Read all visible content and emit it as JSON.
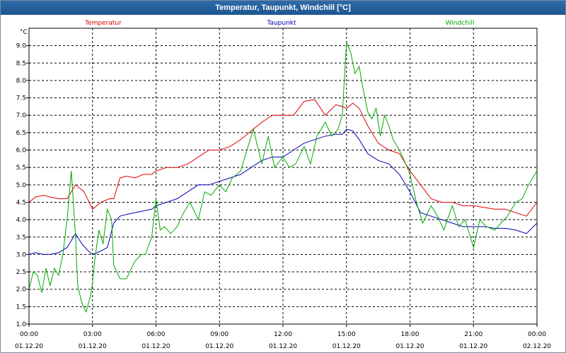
{
  "window": {
    "title": "Temperatur, Taupunkt, Windchill [°C]"
  },
  "colors": {
    "temperatur": "#dd0000",
    "taupunkt": "#0000bb",
    "windchill": "#00aa00",
    "grid": "#000000"
  },
  "chart_data": {
    "type": "line",
    "title": "Temperatur, Taupunkt, Windchill [°C]",
    "ylabel": "°C",
    "ylim": [
      1.0,
      9.5
    ],
    "xlim": [
      0,
      24
    ],
    "yticks": [
      1.0,
      1.5,
      2.0,
      2.5,
      3.0,
      3.5,
      4.0,
      4.5,
      5.0,
      5.5,
      6.0,
      6.5,
      7.0,
      7.5,
      8.0,
      8.5,
      9.0
    ],
    "ytick_labels": [
      "1.0",
      "1.5",
      "2.0",
      "2.5",
      "3.0",
      "3.5",
      "4.0",
      "4.5",
      "5.0",
      "5.5",
      "6.0",
      "6.5",
      "7.0",
      "7.5",
      "8.0",
      "8.5",
      "9.0"
    ],
    "xticks": [
      {
        "time": "00:00",
        "date": "01.12.20"
      },
      {
        "time": "03:00",
        "date": "01.12.20"
      },
      {
        "time": "06:00",
        "date": "01.12.20"
      },
      {
        "time": "09:00",
        "date": "01.12.20"
      },
      {
        "time": "12:00",
        "date": "01.12.20"
      },
      {
        "time": "15:00",
        "date": "01.12.20"
      },
      {
        "time": "18:00",
        "date": "01.12.20"
      },
      {
        "time": "21:00",
        "date": "01.12.20"
      },
      {
        "time": "00:00",
        "date": "02.12.20"
      }
    ],
    "grid": true,
    "series": [
      {
        "name": "Temperatur",
        "color": "#dd0000",
        "x": [
          0,
          0.3,
          0.7,
          1.0,
          1.4,
          1.8,
          2.2,
          2.6,
          3.0,
          3.4,
          3.8,
          4.0,
          4.3,
          4.6,
          5.0,
          5.4,
          5.8,
          6.0,
          6.5,
          7.0,
          7.5,
          8.0,
          8.5,
          9.0,
          9.5,
          10.0,
          10.5,
          11.0,
          11.5,
          12.0,
          12.5,
          13.0,
          13.5,
          14.0,
          14.5,
          14.8,
          15.0,
          15.3,
          15.6,
          16.0,
          16.5,
          17.0,
          17.5,
          18.0,
          18.5,
          19.0,
          19.5,
          20.0,
          20.5,
          21.0,
          21.5,
          22.0,
          22.5,
          23.0,
          23.5,
          24.0
        ],
        "values": [
          4.5,
          4.65,
          4.7,
          4.65,
          4.6,
          4.6,
          5.0,
          4.8,
          4.3,
          4.5,
          4.6,
          4.6,
          5.2,
          5.25,
          5.2,
          5.3,
          5.3,
          5.4,
          5.5,
          5.5,
          5.6,
          5.8,
          6.0,
          6.0,
          6.1,
          6.3,
          6.55,
          6.8,
          7.0,
          7.0,
          7.0,
          7.4,
          7.45,
          7.0,
          7.3,
          7.25,
          7.2,
          7.35,
          7.2,
          6.7,
          6.2,
          6.0,
          5.9,
          5.4,
          5.0,
          4.6,
          4.5,
          4.5,
          4.4,
          4.4,
          4.35,
          4.3,
          4.3,
          4.2,
          4.1,
          4.5
        ]
      },
      {
        "name": "Taupunkt",
        "color": "#0000bb",
        "x": [
          0,
          0.3,
          0.7,
          1.0,
          1.4,
          1.8,
          2.2,
          2.5,
          2.8,
          3.0,
          3.4,
          3.7,
          4.0,
          4.3,
          4.6,
          5.0,
          5.4,
          5.8,
          6.0,
          6.5,
          7.0,
          7.5,
          8.0,
          8.5,
          9.0,
          9.5,
          10.0,
          10.5,
          11.0,
          11.5,
          12.0,
          12.5,
          13.0,
          13.5,
          14.0,
          14.5,
          14.8,
          15.0,
          15.3,
          15.6,
          16.0,
          16.5,
          17.0,
          17.5,
          18.0,
          18.5,
          19.0,
          19.5,
          20.0,
          20.5,
          21.0,
          21.5,
          22.0,
          22.5,
          23.0,
          23.5,
          24.0
        ],
        "values": [
          3.0,
          3.05,
          3.0,
          3.0,
          3.05,
          3.2,
          3.6,
          3.3,
          3.1,
          3.0,
          3.1,
          3.2,
          3.9,
          4.1,
          4.15,
          4.2,
          4.25,
          4.3,
          4.4,
          4.5,
          4.6,
          4.8,
          5.0,
          5.0,
          5.1,
          5.2,
          5.3,
          5.5,
          5.7,
          5.8,
          5.8,
          6.0,
          6.2,
          6.3,
          6.4,
          6.45,
          6.45,
          6.6,
          6.55,
          6.3,
          5.9,
          5.7,
          5.6,
          5.3,
          4.8,
          4.2,
          4.1,
          4.0,
          3.9,
          3.8,
          3.8,
          3.8,
          3.75,
          3.75,
          3.7,
          3.6,
          3.9
        ]
      },
      {
        "name": "Windchill",
        "color": "#00aa00",
        "x": [
          0,
          0.2,
          0.4,
          0.6,
          0.8,
          1.0,
          1.2,
          1.4,
          1.6,
          1.8,
          2.0,
          2.2,
          2.3,
          2.5,
          2.7,
          2.9,
          3.0,
          3.1,
          3.3,
          3.5,
          3.7,
          3.9,
          4.0,
          4.3,
          4.6,
          5.0,
          5.3,
          5.5,
          5.8,
          6.0,
          6.2,
          6.4,
          6.7,
          7.0,
          7.3,
          7.6,
          8.0,
          8.3,
          8.6,
          9.0,
          9.3,
          9.6,
          10.0,
          10.3,
          10.6,
          11.0,
          11.3,
          11.6,
          12.0,
          12.3,
          12.6,
          13.0,
          13.3,
          13.6,
          14.0,
          14.3,
          14.6,
          14.8,
          15.0,
          15.2,
          15.4,
          15.6,
          15.8,
          16.0,
          16.2,
          16.4,
          16.6,
          16.8,
          17.0,
          17.2,
          17.5,
          17.8,
          18.0,
          18.3,
          18.6,
          19.0,
          19.3,
          19.6,
          20.0,
          20.3,
          20.6,
          21.0,
          21.3,
          21.6,
          22.0,
          22.3,
          22.6,
          23.0,
          23.3,
          23.6,
          24.0
        ],
        "values": [
          2.0,
          2.5,
          2.4,
          1.9,
          2.6,
          2.1,
          2.6,
          2.4,
          3.0,
          4.0,
          5.4,
          3.5,
          2.1,
          1.6,
          1.35,
          1.8,
          2.2,
          2.8,
          3.7,
          3.3,
          4.3,
          4.0,
          2.7,
          2.3,
          2.3,
          2.8,
          3.0,
          3.0,
          3.5,
          4.6,
          3.7,
          3.8,
          3.6,
          3.8,
          4.2,
          4.5,
          4.0,
          4.8,
          4.7,
          5.0,
          4.8,
          5.2,
          5.4,
          6.0,
          6.6,
          5.6,
          6.4,
          5.5,
          5.8,
          5.5,
          5.6,
          6.1,
          5.6,
          6.4,
          6.8,
          6.4,
          6.6,
          7.0,
          9.1,
          8.8,
          8.2,
          8.4,
          7.7,
          7.1,
          6.9,
          7.2,
          6.4,
          7.0,
          6.7,
          6.3,
          6.0,
          5.6,
          5.3,
          4.5,
          3.9,
          4.4,
          4.1,
          3.7,
          4.4,
          3.8,
          4.0,
          3.2,
          4.0,
          3.8,
          3.7,
          3.9,
          4.1,
          4.5,
          4.6,
          5.0,
          5.4
        ]
      }
    ]
  }
}
